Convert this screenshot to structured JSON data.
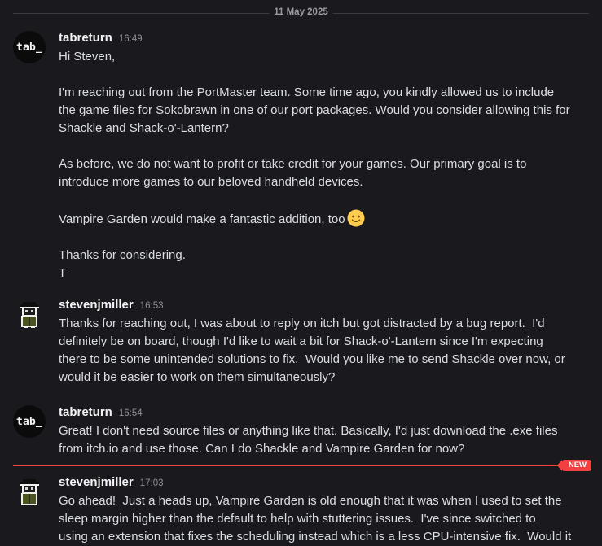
{
  "date_divider": "11 May 2025",
  "messages": [
    {
      "avatar_text": "tab_",
      "username": "tabreturn",
      "time": "16:49",
      "lines": [
        "Hi Steven,",
        "",
        "I'm reaching out from the PortMaster team. Some time ago, you kindly allowed us to include",
        "the game files for Sokobrawn in one of our port packages. Would you consider allowing this for",
        "Shackle and Shack-o'-Lantern?",
        "",
        "As before, we do not want to profit or take credit for your games. Our primary goal is to",
        "introduce more games to our beloved handheld devices.",
        "",
        "Vampire Garden would make a fantastic addition, too",
        "",
        "Thanks for considering.",
        "T"
      ],
      "emoji": "slightly-smiling-face-icon"
    },
    {
      "username": "stevenjmiller",
      "time": "16:53",
      "lines": [
        "Thanks for reaching out, I was about to reply on itch but got distracted by a bug report.  I'd",
        "definitely be on board, though I'd like to wait a bit for Shack-o'-Lantern since I'm expecting",
        "there to be some unintended solutions to fix.  Would you like me to send Shackle over now, or",
        "would it be easier to work on them simultaneously?"
      ]
    },
    {
      "avatar_text": "tab_",
      "username": "tabreturn",
      "time": "16:54",
      "lines": [
        "Great! I don't need source files or anything like that. Basically, I'd just download the .exe files",
        "from itch.io and use those. Can I do Shackle and Vampire Garden for now?"
      ]
    },
    {
      "username": "stevenjmiller",
      "time": "17:03",
      "lines": [
        "Go ahead!  Just a heads up, Vampire Garden is old enough that it was when I used to set the",
        "sleep margin higher than the default to help with stuttering issues.  I've since switched to",
        "using an extension that fixes the scheduling instead which is a less CPU-intensive fix.  Would it"
      ]
    }
  ],
  "new_badge": "NEW",
  "colors": {
    "accent_red": "#f23f42",
    "background": "#1a1a1e"
  }
}
